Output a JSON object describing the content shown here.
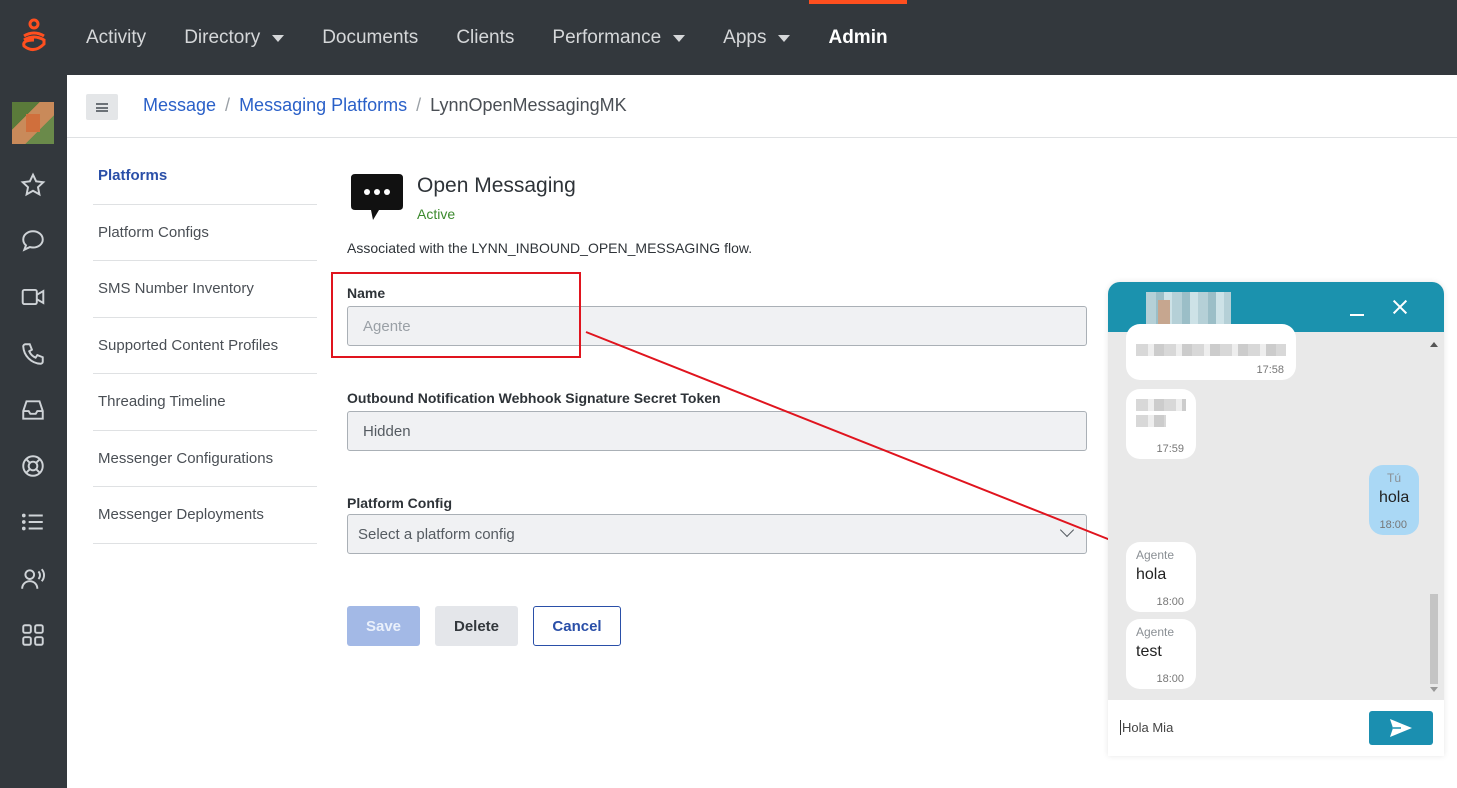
{
  "topnav": {
    "items": [
      {
        "label": "Activity",
        "caret": false,
        "active": false
      },
      {
        "label": "Directory",
        "caret": true,
        "active": false
      },
      {
        "label": "Documents",
        "caret": false,
        "active": false
      },
      {
        "label": "Clients",
        "caret": false,
        "active": false
      },
      {
        "label": "Performance",
        "caret": true,
        "active": false
      },
      {
        "label": "Apps",
        "caret": true,
        "active": false
      },
      {
        "label": "Admin",
        "caret": false,
        "active": true
      }
    ],
    "accent": "#ff4f1f"
  },
  "rail": {
    "icons": [
      "star-icon",
      "chat-icon",
      "video-icon",
      "phone-icon",
      "inbox-icon",
      "lifebuoy-icon",
      "list-icon",
      "people-icon",
      "apps-grid-icon"
    ]
  },
  "breadcrumb": {
    "items": [
      "Message",
      "Messaging Platforms"
    ],
    "current": "LynnOpenMessagingMK"
  },
  "subnav": {
    "items": [
      {
        "label": "Platforms",
        "active": true
      },
      {
        "label": "Platform Configs",
        "active": false
      },
      {
        "label": "SMS Number Inventory",
        "active": false
      },
      {
        "label": "Supported Content Profiles",
        "active": false
      },
      {
        "label": "Threading Timeline",
        "active": false
      },
      {
        "label": "Messenger Configurations",
        "active": false
      },
      {
        "label": "Messenger Deployments",
        "active": false
      }
    ]
  },
  "platform": {
    "title": "Open Messaging",
    "status": "Active",
    "status_color": "#3c8a2e",
    "associated": "Associated with the LYNN_INBOUND_OPEN_MESSAGING flow."
  },
  "form": {
    "name_label": "Name",
    "name_value": "Agente",
    "token_label": "Outbound Notification Webhook Signature Secret Token",
    "token_value": "Hidden",
    "config_label": "Platform Config",
    "config_placeholder": "Select a platform config"
  },
  "buttons": {
    "save": "Save",
    "delete": "Delete",
    "cancel": "Cancel"
  },
  "chat": {
    "header_color": "#1b92ae",
    "messages": [
      {
        "who": "",
        "text": "",
        "time": "17:58",
        "me": false,
        "blurred": true
      },
      {
        "who": "",
        "text": "",
        "time": "17:59",
        "me": false,
        "blurred": true
      },
      {
        "who": "Tú",
        "text": "hola",
        "time": "18:00",
        "me": true
      },
      {
        "who": "Agente",
        "text": "hola",
        "time": "18:00",
        "me": false
      },
      {
        "who": "Agente",
        "text": "test",
        "time": "18:00",
        "me": false
      }
    ],
    "input_value": "Hola Mia"
  }
}
